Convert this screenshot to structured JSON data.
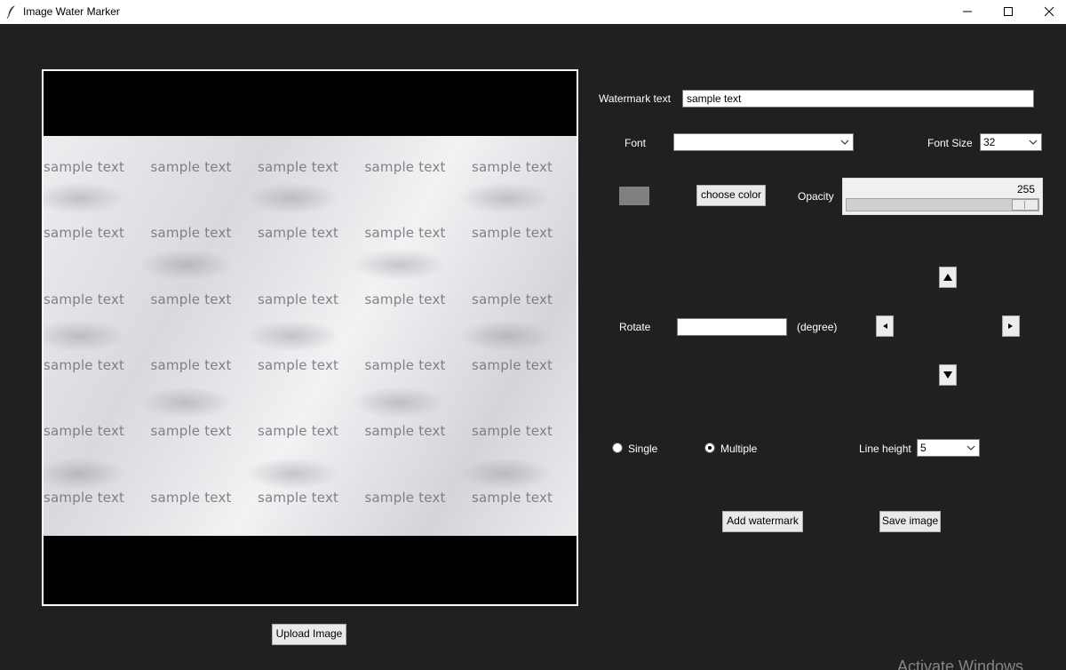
{
  "window": {
    "title": "Image Water Marker",
    "controls": [
      "minimize-icon",
      "maximize-icon",
      "close-icon"
    ]
  },
  "preview": {
    "watermark_rows": 6,
    "watermark_cols": 5,
    "watermark_text": "sample text"
  },
  "upload_button": "Upload Image",
  "form": {
    "watermark_label": "Watermark text",
    "watermark_value": "sample text",
    "font_label": "Font",
    "font_value": "",
    "font_size_label": "Font Size",
    "font_size_value": "32",
    "choose_color_label": "choose color",
    "color_swatch": "#808080",
    "opacity_label": "Opacity",
    "opacity_value": "255",
    "opacity_fraction": 1.0,
    "rotate_label": "Rotate",
    "rotate_value": "",
    "rotate_unit": "(degree)",
    "arrows": [
      "up-arrow-icon",
      "left-arrow-icon",
      "right-arrow-icon",
      "down-arrow-icon"
    ],
    "mode_single": "Single",
    "mode_multiple": "Multiple",
    "mode_selected": "Multiple",
    "line_height_label": "Line height",
    "line_height_value": "5",
    "add_watermark_button": "Add watermark",
    "save_image_button": "Save image"
  },
  "os_overlay": "Activate Windows"
}
